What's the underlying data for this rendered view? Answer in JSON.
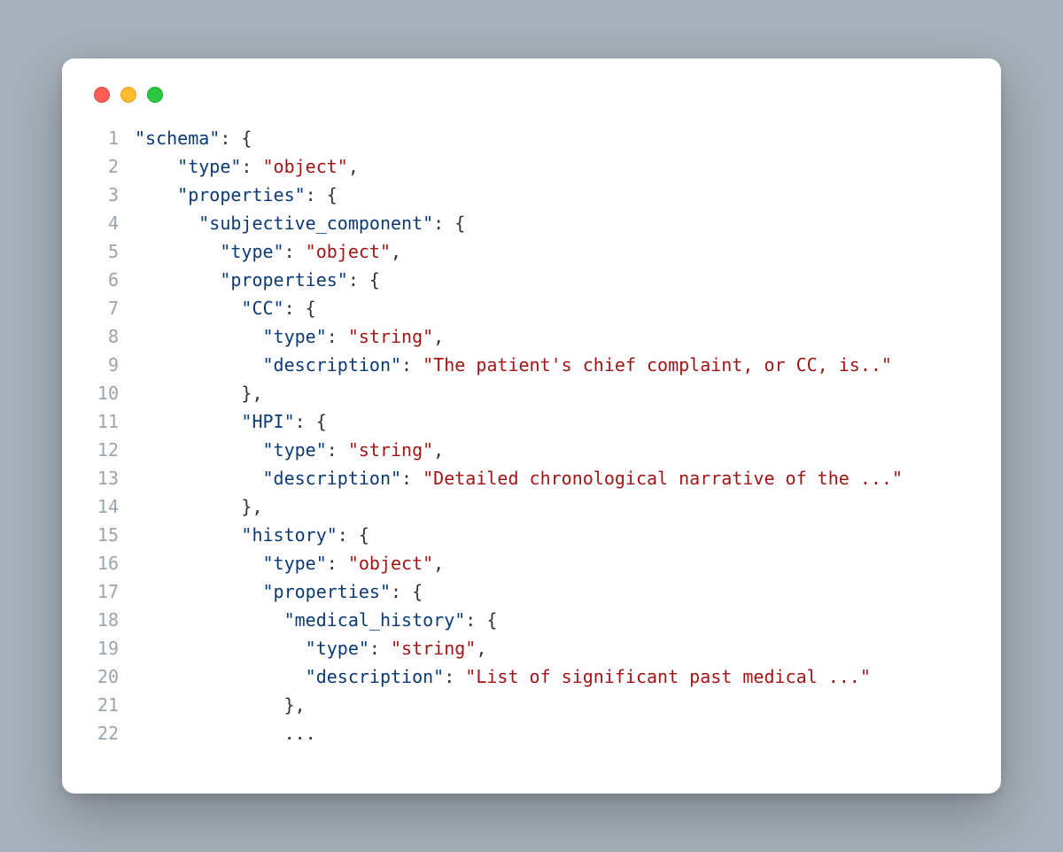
{
  "traffic_lights": {
    "red": "#ff5f57",
    "yellow": "#febc2e",
    "green": "#28c840"
  },
  "code": {
    "lines": [
      {
        "n": "1",
        "indent": 0,
        "tokens": [
          {
            "t": "key",
            "v": "\"schema\""
          },
          {
            "t": "punct",
            "v": ": {"
          }
        ]
      },
      {
        "n": "2",
        "indent": 2,
        "tokens": [
          {
            "t": "key",
            "v": "\"type\""
          },
          {
            "t": "punct",
            "v": ": "
          },
          {
            "t": "str",
            "v": "\"object\""
          },
          {
            "t": "punct",
            "v": ","
          }
        ]
      },
      {
        "n": "3",
        "indent": 2,
        "tokens": [
          {
            "t": "key",
            "v": "\"properties\""
          },
          {
            "t": "punct",
            "v": ": {"
          }
        ]
      },
      {
        "n": "4",
        "indent": 3,
        "tokens": [
          {
            "t": "key",
            "v": "\"subjective_component\""
          },
          {
            "t": "punct",
            "v": ": {"
          }
        ]
      },
      {
        "n": "5",
        "indent": 4,
        "tokens": [
          {
            "t": "key",
            "v": "\"type\""
          },
          {
            "t": "punct",
            "v": ": "
          },
          {
            "t": "str",
            "v": "\"object\""
          },
          {
            "t": "punct",
            "v": ","
          }
        ]
      },
      {
        "n": "6",
        "indent": 4,
        "tokens": [
          {
            "t": "key",
            "v": "\"properties\""
          },
          {
            "t": "punct",
            "v": ": {"
          }
        ]
      },
      {
        "n": "7",
        "indent": 5,
        "tokens": [
          {
            "t": "key",
            "v": "\"CC\""
          },
          {
            "t": "punct",
            "v": ": {"
          }
        ]
      },
      {
        "n": "8",
        "indent": 6,
        "tokens": [
          {
            "t": "key",
            "v": "\"type\""
          },
          {
            "t": "punct",
            "v": ": "
          },
          {
            "t": "str",
            "v": "\"string\""
          },
          {
            "t": "punct",
            "v": ","
          }
        ]
      },
      {
        "n": "9",
        "indent": 6,
        "tokens": [
          {
            "t": "key",
            "v": "\"description\""
          },
          {
            "t": "punct",
            "v": ": "
          },
          {
            "t": "str",
            "v": "\"The patient's chief complaint, or CC, is..\""
          }
        ]
      },
      {
        "n": "10",
        "indent": 5,
        "tokens": [
          {
            "t": "punct",
            "v": "},"
          }
        ]
      },
      {
        "n": "11",
        "indent": 5,
        "tokens": [
          {
            "t": "key",
            "v": "\"HPI\""
          },
          {
            "t": "punct",
            "v": ": {"
          }
        ]
      },
      {
        "n": "12",
        "indent": 6,
        "tokens": [
          {
            "t": "key",
            "v": "\"type\""
          },
          {
            "t": "punct",
            "v": ": "
          },
          {
            "t": "str",
            "v": "\"string\""
          },
          {
            "t": "punct",
            "v": ","
          }
        ]
      },
      {
        "n": "13",
        "indent": 6,
        "tokens": [
          {
            "t": "key",
            "v": "\"description\""
          },
          {
            "t": "punct",
            "v": ": "
          },
          {
            "t": "str",
            "v": "\"Detailed chronological narrative of the ...\""
          }
        ]
      },
      {
        "n": "14",
        "indent": 5,
        "tokens": [
          {
            "t": "punct",
            "v": "},"
          }
        ]
      },
      {
        "n": "15",
        "indent": 5,
        "tokens": [
          {
            "t": "key",
            "v": "\"history\""
          },
          {
            "t": "punct",
            "v": ": {"
          }
        ]
      },
      {
        "n": "16",
        "indent": 6,
        "tokens": [
          {
            "t": "key",
            "v": "\"type\""
          },
          {
            "t": "punct",
            "v": ": "
          },
          {
            "t": "str",
            "v": "\"object\""
          },
          {
            "t": "punct",
            "v": ","
          }
        ]
      },
      {
        "n": "17",
        "indent": 6,
        "tokens": [
          {
            "t": "key",
            "v": "\"properties\""
          },
          {
            "t": "punct",
            "v": ": {"
          }
        ]
      },
      {
        "n": "18",
        "indent": 7,
        "tokens": [
          {
            "t": "key",
            "v": "\"medical_history\""
          },
          {
            "t": "punct",
            "v": ": {"
          }
        ]
      },
      {
        "n": "19",
        "indent": 8,
        "tokens": [
          {
            "t": "key",
            "v": "\"type\""
          },
          {
            "t": "punct",
            "v": ": "
          },
          {
            "t": "str",
            "v": "\"string\""
          },
          {
            "t": "punct",
            "v": ","
          }
        ]
      },
      {
        "n": "20",
        "indent": 8,
        "tokens": [
          {
            "t": "key",
            "v": "\"description\""
          },
          {
            "t": "punct",
            "v": ": "
          },
          {
            "t": "str",
            "v": "\"List of significant past medical ...\""
          }
        ]
      },
      {
        "n": "21",
        "indent": 7,
        "tokens": [
          {
            "t": "punct",
            "v": "},"
          }
        ]
      },
      {
        "n": "22",
        "indent": 7,
        "tokens": [
          {
            "t": "ellip",
            "v": "..."
          }
        ]
      }
    ]
  }
}
